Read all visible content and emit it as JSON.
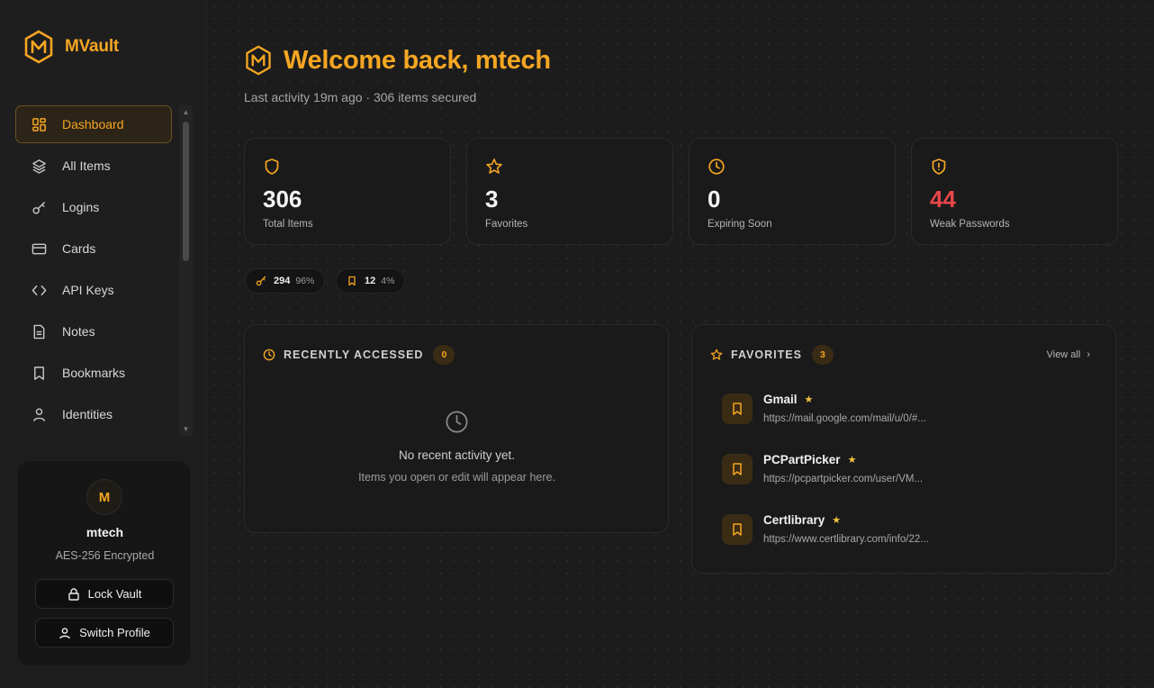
{
  "brand": {
    "name": "MVault",
    "logo_letter": "M",
    "accent": "#f5a623"
  },
  "nav": {
    "items": [
      {
        "label": "Dashboard",
        "icon": "dashboard-icon",
        "active": true
      },
      {
        "label": "All Items",
        "icon": "layers-icon"
      },
      {
        "label": "Logins",
        "icon": "key-icon"
      },
      {
        "label": "Cards",
        "icon": "card-icon"
      },
      {
        "label": "API Keys",
        "icon": "code-icon"
      },
      {
        "label": "Notes",
        "icon": "note-icon"
      },
      {
        "label": "Bookmarks",
        "icon": "bookmark-icon"
      },
      {
        "label": "Identities",
        "icon": "user-icon"
      }
    ]
  },
  "profile": {
    "avatar_letter": "M",
    "name": "mtech",
    "encryption": "AES-256 Encrypted",
    "lock_label": "Lock Vault",
    "switch_label": "Switch Profile"
  },
  "header": {
    "title": "Welcome back, mtech",
    "subtitle": "Last activity 19m ago · 306 items secured"
  },
  "stats": [
    {
      "value": "306",
      "label": "Total Items",
      "icon": "shield-icon",
      "alert": false
    },
    {
      "value": "3",
      "label": "Favorites",
      "icon": "star-icon",
      "alert": false
    },
    {
      "value": "0",
      "label": "Expiring Soon",
      "icon": "clock-icon",
      "alert": false
    },
    {
      "value": "44",
      "label": "Weak Passwords",
      "icon": "shield-alert-icon",
      "alert": true,
      "alert_color": "#e8474b"
    }
  ],
  "breakdown": [
    {
      "icon": "key-icon",
      "count": "294",
      "percent": "96%"
    },
    {
      "icon": "bookmark-icon",
      "count": "12",
      "percent": "4%"
    }
  ],
  "recent": {
    "title": "RECENTLY ACCESSED",
    "count": "0",
    "empty_title": "No recent activity yet.",
    "empty_sub": "Items you open or edit will appear here."
  },
  "favorites": {
    "title": "FAVORITES",
    "count": "3",
    "view_all": "View all",
    "items": [
      {
        "name": "Gmail",
        "url": "https://mail.google.com/mail/u/0/#..."
      },
      {
        "name": "PCPartPicker",
        "url": "https://pcpartpicker.com/user/VM..."
      },
      {
        "name": "Certlibrary",
        "url": "https://www.certlibrary.com/info/22..."
      }
    ]
  }
}
